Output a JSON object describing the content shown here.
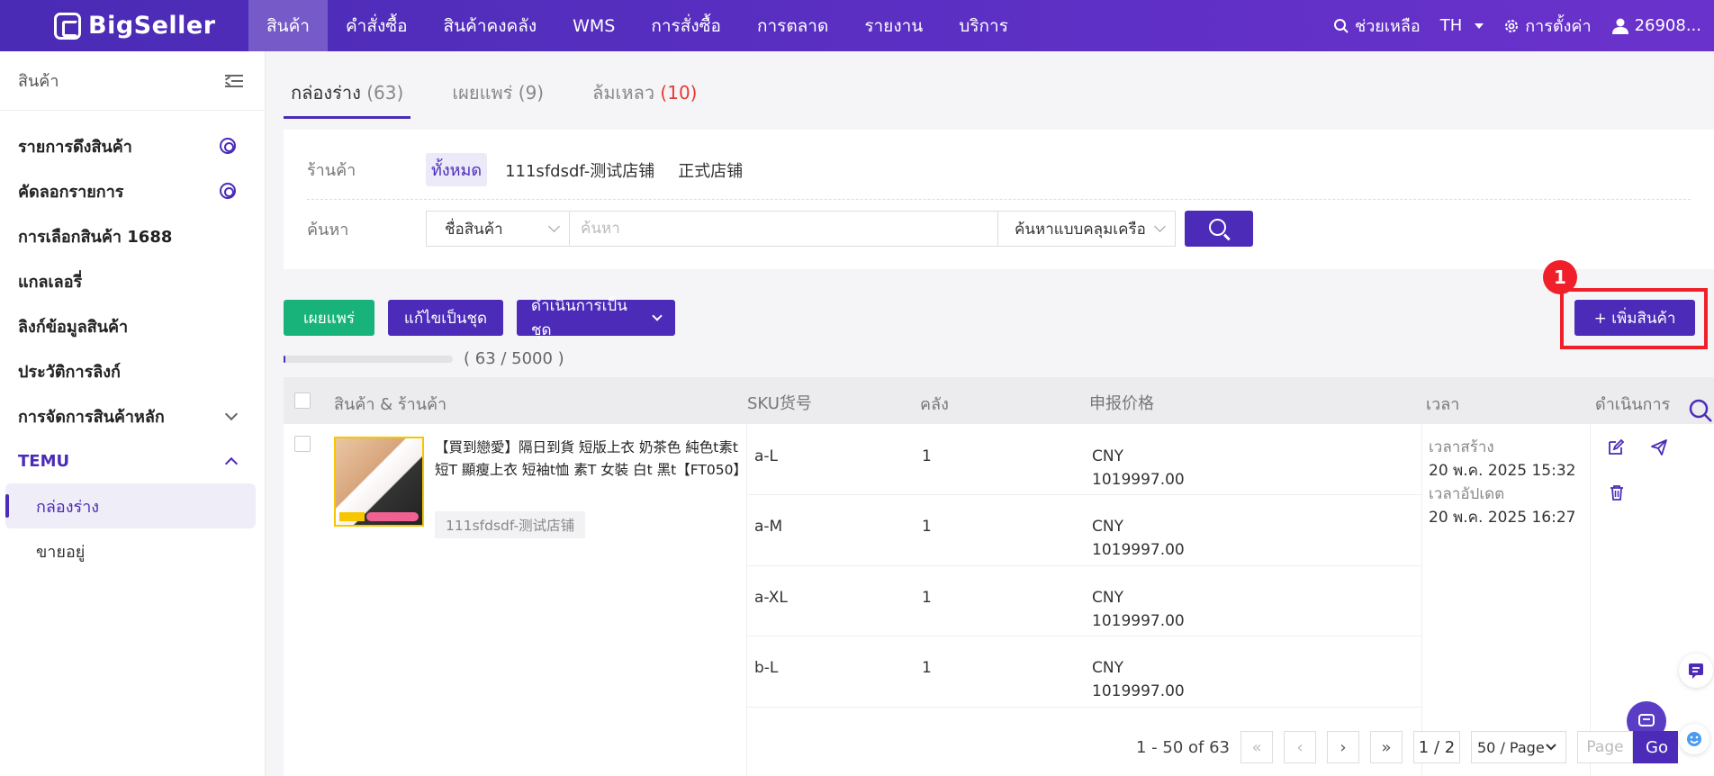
{
  "brand": {
    "name": "BigSeller"
  },
  "nav": {
    "items": [
      "สินค้า",
      "คำสั่งซื้อ",
      "สินค้าคงคลัง",
      "WMS",
      "การสั่งซื้อ",
      "การตลาด",
      "รายงาน",
      "บริการ"
    ],
    "active_index": 0
  },
  "topright": {
    "help": "ช่วยเหลือ",
    "lang": "TH",
    "settings": "การตั้งค่า",
    "user": "26908..."
  },
  "sidebar": {
    "title": "สินค้า",
    "items": [
      {
        "label": "รายการดึงสินค้า",
        "icon": "gear-icon"
      },
      {
        "label": "คัดลอกรายการ",
        "icon": "gear-icon"
      },
      {
        "label": "การเลือกสินค้า 1688"
      },
      {
        "label": "แกลเลอรี่"
      },
      {
        "label": "ลิงก์ข้อมูลสินค้า"
      },
      {
        "label": "ประวัติการลิงก์"
      },
      {
        "label": "การจัดการสินค้าหลัก",
        "icon": "chevron-down-icon"
      },
      {
        "label": "TEMU",
        "icon": "chevron-up-icon"
      }
    ],
    "subitems": [
      "กล่องร่าง",
      "ขายอยู่"
    ],
    "active_sub": 0
  },
  "tabs": [
    {
      "label": "กล่องร่าง",
      "count": "(63)"
    },
    {
      "label": "เผยแพร่",
      "count": "(9)"
    },
    {
      "label": "ล้มเหลว",
      "count": "(10)"
    }
  ],
  "filter": {
    "shop_label": "ร้านค้า",
    "shops": [
      "ทั้งหมด",
      "111sfdsdf-测试店铺",
      "正式店铺"
    ],
    "search_label": "ค้นหา",
    "search_field": "ชื่อสินค้า",
    "search_placeholder": "ค้นหา",
    "search_mode": "ค้นหาแบบคลุมเครือ"
  },
  "actions": {
    "publish": "เผยแพร่",
    "batch_edit": "แก้ไขเป็นชุด",
    "batch_ops": "ดำเนินการเป็นชุด",
    "add_product": "+ เพิ่มสินค้า"
  },
  "annotation": {
    "step": "1"
  },
  "progress": {
    "text": "( 63 / 5000 )",
    "fraction": 0.0126
  },
  "table": {
    "headers": [
      "สินค้า & ร้านค้า",
      "SKU货号",
      "คลัง",
      "申报价格",
      "เวลา",
      "ดำเนินการ"
    ],
    "product": {
      "name": "【買到戀愛】隔日到貨 短版上衣 奶茶色 純色t素t 短T 顯瘦上衣 短袖t恤 素T 女裝 白t 黑t【FT050】",
      "shop": "111sfdsdf-测试店铺",
      "created_label": "เวลาสร้าง",
      "created": "20 พ.ค. 2025 15:32",
      "updated_label": "เวลาอัปเดต",
      "updated": "20 พ.ค. 2025 16:27"
    },
    "skus": [
      {
        "sku": "a-L",
        "stock": "1",
        "currency": "CNY",
        "price": "1019997.00"
      },
      {
        "sku": "a-M",
        "stock": "1",
        "currency": "CNY",
        "price": "1019997.00"
      },
      {
        "sku": "a-XL",
        "stock": "1",
        "currency": "CNY",
        "price": "1019997.00"
      },
      {
        "sku": "b-L",
        "stock": "1",
        "currency": "CNY",
        "price": "1019997.00"
      }
    ]
  },
  "pager": {
    "summary": "1 - 50 of 63",
    "page": "1 / 2",
    "per_page": "50 / Page",
    "page_placeholder": "Page",
    "go": "Go"
  }
}
